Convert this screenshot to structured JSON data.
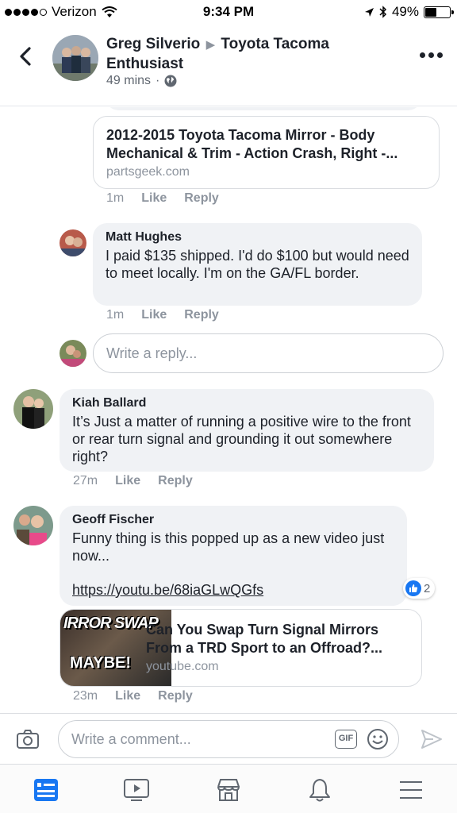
{
  "status_bar": {
    "carrier": "Verizon",
    "time": "9:34 PM",
    "battery": "49%",
    "battery_level": 0.49
  },
  "header": {
    "author": "Greg Silverio",
    "group": "Toyota Tacoma Enthusiast",
    "time": "49 mins",
    "privacy_icon": "globe-icon"
  },
  "comments": {
    "greg_link": {
      "title": "2012-2015 Toyota Tacoma Mirror - Body Mechanical & Trim - Action Crash, Right -...",
      "domain": "partsgeek.com",
      "time": "1m",
      "like": "Like",
      "reply": "Reply"
    },
    "matt": {
      "name": "Matt Hughes",
      "text": "I paid $135 shipped. I'd do $100 but would need to meet locally. I'm on the GA/FL border.",
      "time": "1m",
      "like": "Like",
      "reply": "Reply"
    },
    "reply_placeholder": "Write a reply...",
    "kiah": {
      "name": "Kiah Ballard",
      "text": "It’s Just a matter of running a positive wire to the front or rear turn signal and grounding it out somewhere right?",
      "time": "27m",
      "like": "Like",
      "reply": "Reply"
    },
    "geoff": {
      "name": "Geoff Fischer",
      "text": "Funny thing is this popped up as a new video just now...",
      "link": "https://youtu.be/68iaGLwQGfs",
      "reaction_count": "2",
      "card_title": "Can You Swap Turn Signal Mirrors From a TRD Sport to an Offroad?...",
      "card_domain": "youtube.com",
      "thumb_text_top": "IRROR SWAP",
      "thumb_text_bottom": "MAYBE!",
      "time": "23m",
      "like": "Like",
      "reply": "Reply"
    }
  },
  "composer": {
    "placeholder": "Write a comment...",
    "gif_label": "GIF"
  },
  "tabs": [
    "news-feed",
    "watch",
    "marketplace",
    "notifications",
    "menu"
  ],
  "colors": {
    "accent": "#1877f2",
    "bubble": "#f0f2f5",
    "muted": "#8d949e"
  }
}
